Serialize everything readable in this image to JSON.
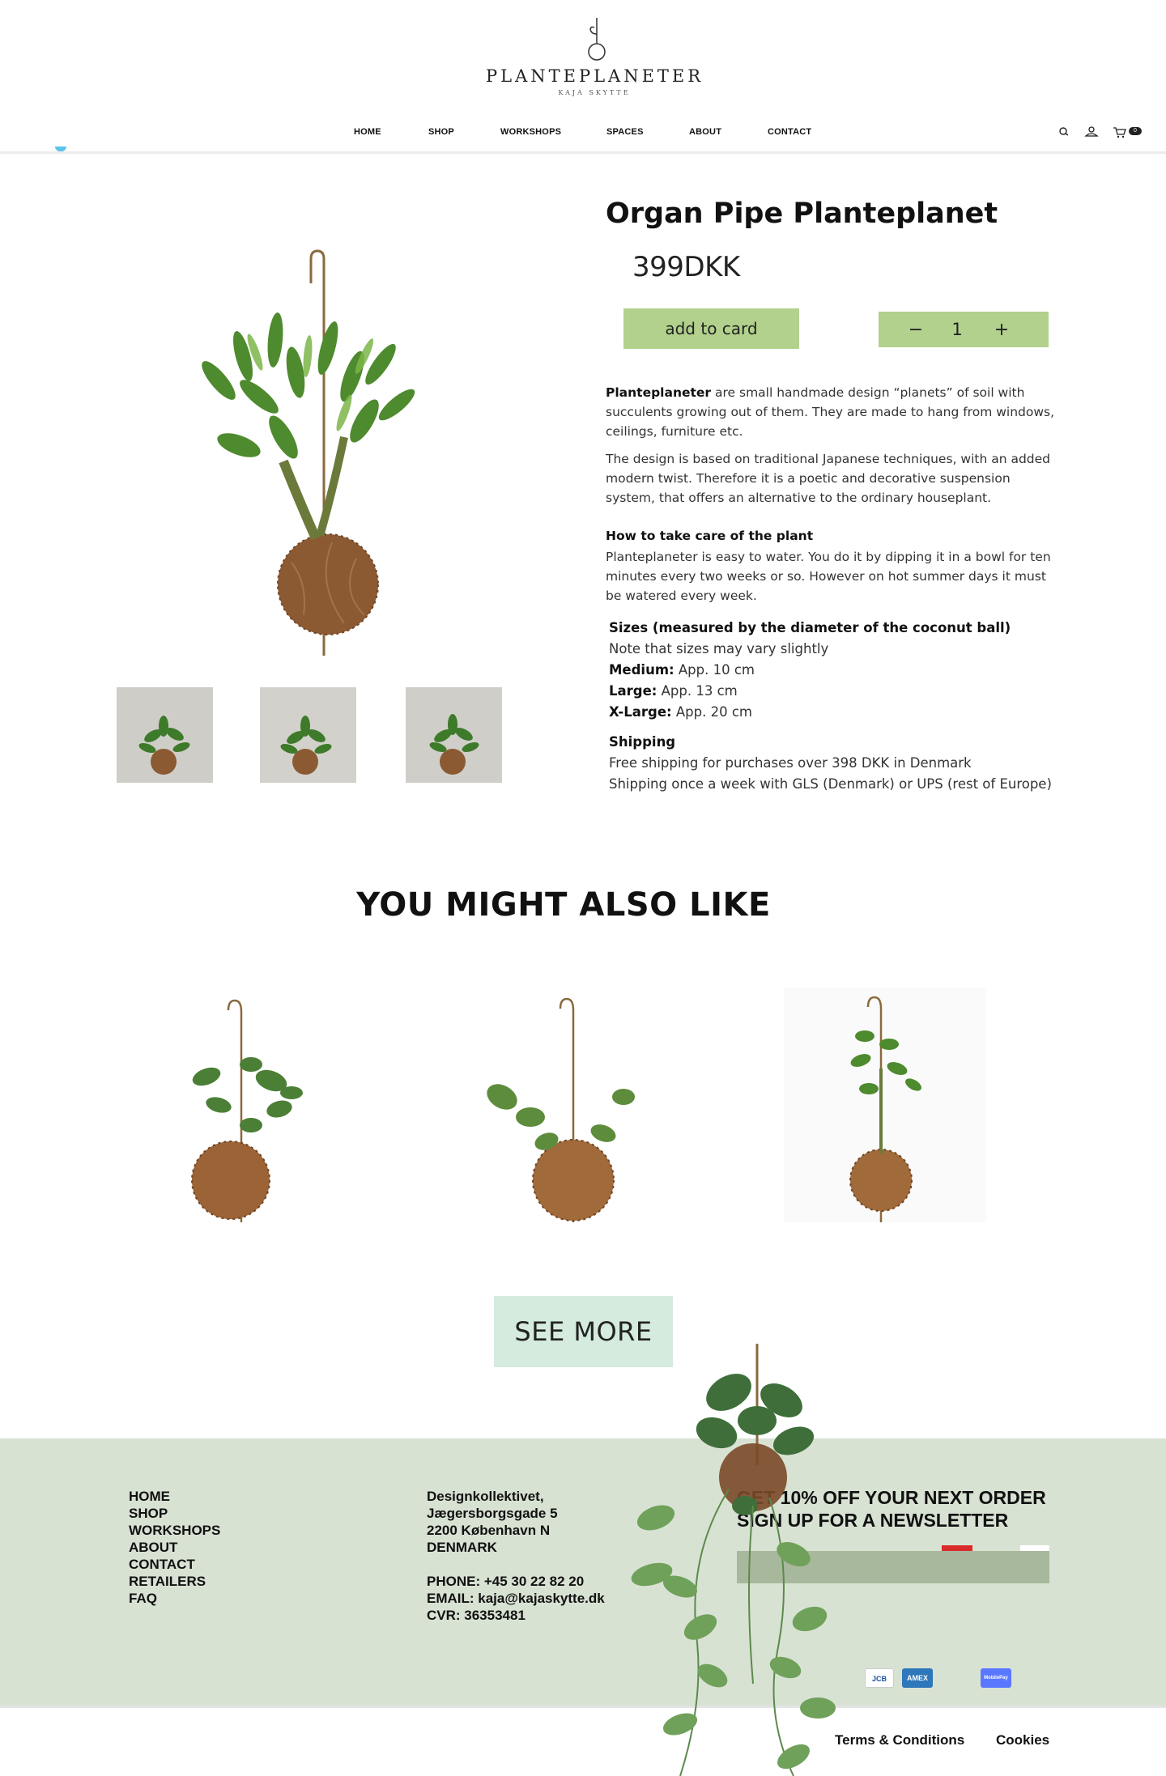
{
  "brand": {
    "name": "PLANTEPLANETER",
    "tagline": "KAJA SKYTTE"
  },
  "nav": {
    "items": [
      {
        "label": "HOME"
      },
      {
        "label": "SHOP"
      },
      {
        "label": "WORKSHOPS"
      },
      {
        "label": "SPACES"
      },
      {
        "label": "ABOUT"
      },
      {
        "label": "CONTACT"
      }
    ]
  },
  "header_icons": [
    "search-icon",
    "user-icon",
    "cart-icon"
  ],
  "cart": {
    "count": "0"
  },
  "product": {
    "title": "Organ Pipe Planteplanet",
    "price": "399DKK",
    "add_label": "add to card",
    "quantity": "1",
    "minus_label": "−",
    "plus_label": "+",
    "intro_bold": "Planteplaneter",
    "intro_text": " are small handmade design “planets” of soil with succulents growing out of them. They are made to hang from windows, ceilings, furniture etc.",
    "design_text": "The design is based on traditional Japanese techniques, with an added modern twist. Therefore it is a poetic and decorative suspension system, that offers an alternative to the ordinary houseplant.",
    "care_heading": "How to take care of the plant",
    "care_text": "Planteplaneter is easy to water. You do it by dipping it in a bowl for ten minutes every two weeks or so. However on hot summer days it must be watered every week.",
    "sizes_heading": "Sizes (measured by the diameter of the coconut ball)",
    "sizes_note": "Note that sizes may vary slightly",
    "sizes": [
      {
        "label": "Medium:",
        "value": " App. 10 cm"
      },
      {
        "label": "Large:",
        "value": " App. 13 cm"
      },
      {
        "label": "X-Large:",
        "value": " App. 20 cm"
      }
    ],
    "shipping_heading": "Shipping",
    "shipping_lines": [
      "Free shipping for purchases over 398 DKK in Denmark",
      "Shipping once a week with GLS (Denmark) or UPS (rest of Europe)"
    ]
  },
  "recommendations": {
    "heading": "YOU MIGHT ALSO LIKE",
    "see_more": "SEE MORE"
  },
  "footer": {
    "links": [
      "HOME",
      "SHOP",
      "WORKSHOPS",
      "ABOUT",
      "CONTACT",
      "RETAILERS",
      "FAQ"
    ],
    "address": [
      "Designkollektivet,",
      "Jægersborgsgade 5",
      "2200 København N",
      "DENMARK"
    ],
    "contact": [
      "PHONE: +45 30 22 82 20",
      "EMAIL: kaja@kajaskytte.dk",
      "CVR: 36353481"
    ],
    "newsletter_line1": "GET 10% OFF YOUR NEXT ORDER",
    "newsletter_line2": "SIGN UP FOR A NEWSLETTER",
    "payments": [
      {
        "label": "JCB",
        "color": "#ffffff"
      },
      {
        "label": "AMEX",
        "color": "#2e77bb"
      },
      {
        "label": "MobilePay",
        "color": "#5a78ff"
      }
    ],
    "legal": [
      "Terms & Conditions",
      "Cookies"
    ]
  },
  "colors": {
    "accent_green": "#b1d18c",
    "see_more_bg": "#d4ebdd",
    "footer_bg": "#d8e2d3",
    "newsletter_field": "#a8b89c"
  }
}
